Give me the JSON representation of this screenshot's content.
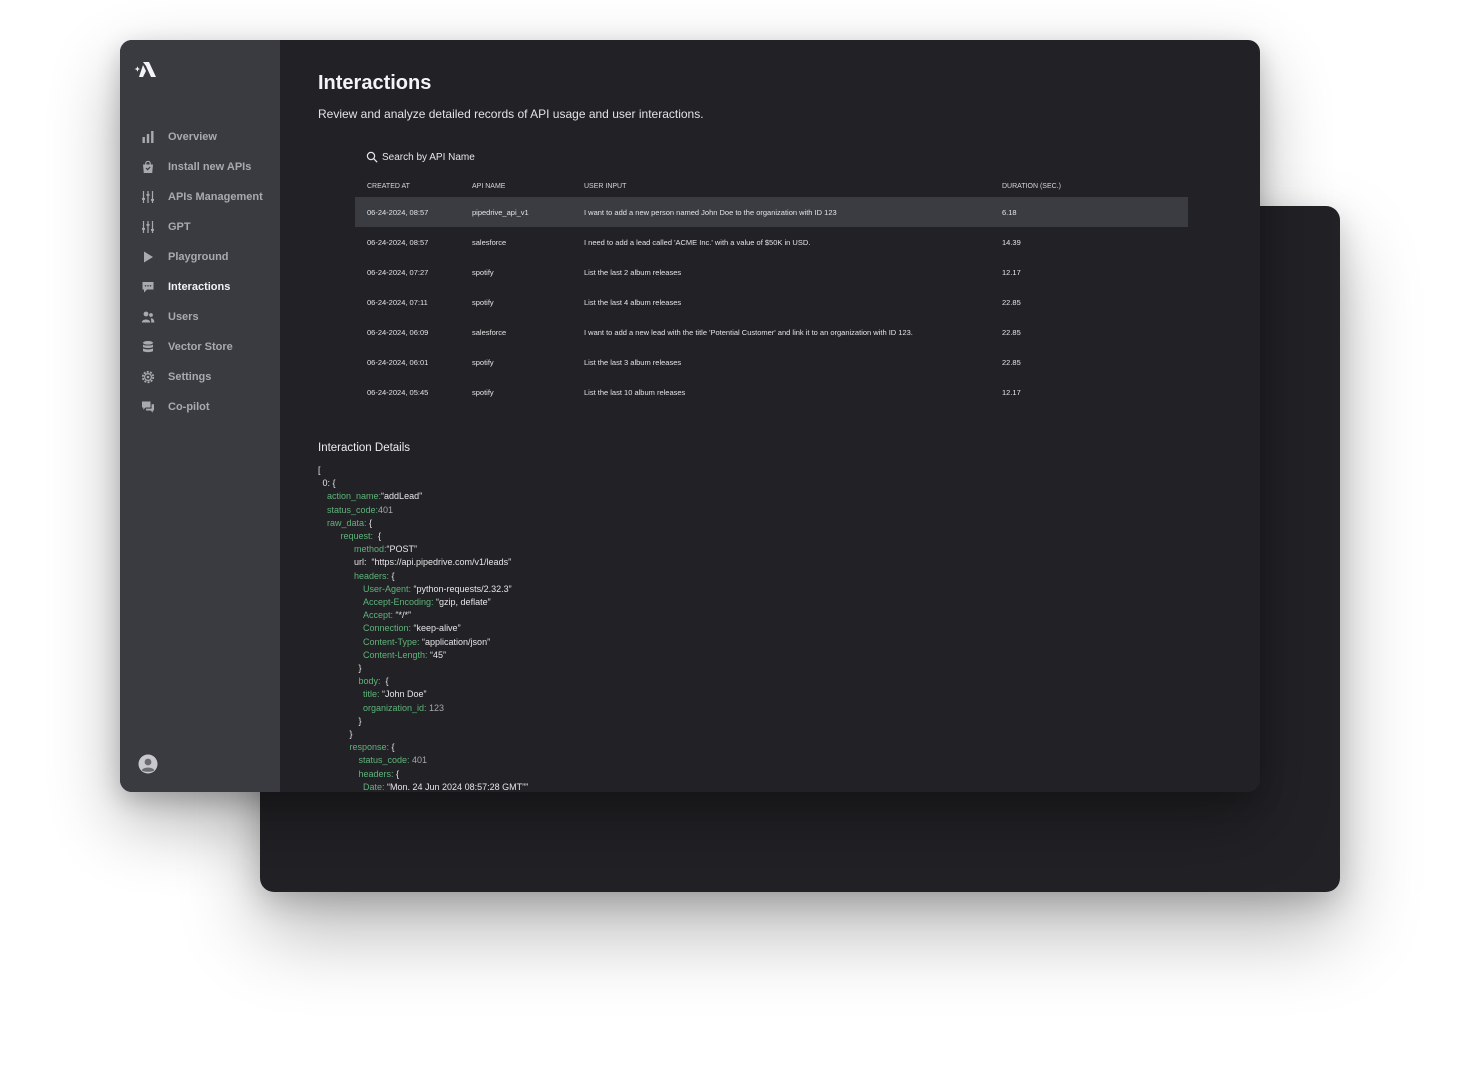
{
  "sidebar": {
    "items": [
      {
        "label": "Overview",
        "icon": "bar-chart-icon"
      },
      {
        "label": "Install new APIs",
        "icon": "shopping-bag-icon"
      },
      {
        "label": "APIs Management",
        "icon": "sliders-icon"
      },
      {
        "label": "GPT",
        "icon": "sliders-icon"
      },
      {
        "label": "Playground",
        "icon": "play-icon"
      },
      {
        "label": "Interactions",
        "icon": "chat-bubble-icon",
        "active": true
      },
      {
        "label": "Users",
        "icon": "users-icon"
      },
      {
        "label": "Vector Store",
        "icon": "database-icon"
      },
      {
        "label": "Settings",
        "icon": "gear-icon"
      },
      {
        "label": "Co-pilot",
        "icon": "chat-bubbles-icon"
      }
    ]
  },
  "page": {
    "title": "Interactions",
    "subtitle": "Review and analyze detailed records of API usage and user interactions."
  },
  "search": {
    "placeholder": "Search by API Name"
  },
  "table": {
    "headers": {
      "created_at": "CREATED AT",
      "api_name": "API NAME",
      "user_input": "USER INPUT",
      "duration": "DURATION (SEC.)"
    },
    "rows": [
      {
        "created_at": "06-24-2024, 08:57",
        "api_name": "pipedrive_api_v1",
        "user_input": "I want to add a new person named John Doe to the organization with ID 123",
        "duration": "6.18",
        "selected": true
      },
      {
        "created_at": "06-24-2024, 08:57",
        "api_name": "salesforce",
        "user_input": "I need to add a lead called 'ACME Inc.' with a value of $50K in USD.",
        "duration": "14.39"
      },
      {
        "created_at": "06-24-2024, 07:27",
        "api_name": "spotify",
        "user_input": "List the last 2 album releases",
        "duration": "12.17"
      },
      {
        "created_at": "06-24-2024, 07:11",
        "api_name": "spotify",
        "user_input": "List the last 4 album releases",
        "duration": "22.85"
      },
      {
        "created_at": "06-24-2024, 06:09",
        "api_name": "salesforce",
        "user_input": "I want to add a new lead with the title 'Potential Customer' and link it to an organization with ID 123.",
        "duration": "22.85"
      },
      {
        "created_at": "06-24-2024, 06:01",
        "api_name": "spotify",
        "user_input": "List the last 3 album releases",
        "duration": "22.85"
      },
      {
        "created_at": "06-24-2024, 05:45",
        "api_name": "spotify",
        "user_input": "List the last 10 album releases",
        "duration": "12.17"
      }
    ]
  },
  "details": {
    "title": "Interaction Details",
    "lines": [
      {
        "indent": 0,
        "text": "["
      },
      {
        "indent": 1,
        "text": "0: {"
      },
      {
        "indent": 2,
        "key": "action_name:",
        "value": "“addLead”"
      },
      {
        "indent": 2,
        "key": "status_code:",
        "value": "401",
        "num": true
      },
      {
        "indent": 2,
        "key": "raw_data:",
        "value": " {"
      },
      {
        "indent": 5,
        "key": "request:",
        "value": "  {"
      },
      {
        "indent": 8,
        "key": "method:",
        "value": "“POST”"
      },
      {
        "indent": 8,
        "text": "url:  “https://api.pipedrive.com/v1/leads”"
      },
      {
        "indent": 8,
        "key": "headers:",
        "value": " {"
      },
      {
        "indent": 10,
        "key": "User-Agent:",
        "value": " “python-requests/2.32.3”"
      },
      {
        "indent": 10,
        "key": "Accept-Encoding:",
        "value": " “gzip, deflate”"
      },
      {
        "indent": 10,
        "key": "Accept:",
        "value": " “*/*”"
      },
      {
        "indent": 10,
        "key": "Connection:",
        "value": " “keep-alive”"
      },
      {
        "indent": 10,
        "key": "Content-Type:",
        "value": " “application/json”"
      },
      {
        "indent": 10,
        "key": "Content-Length:",
        "value": " “45”"
      },
      {
        "indent": 9,
        "text": "}"
      },
      {
        "indent": 9,
        "key": "body:",
        "value": "  {"
      },
      {
        "indent": 10,
        "key": "title:",
        "value": " “John Doe”"
      },
      {
        "indent": 10,
        "key": "organization_id:",
        "value": " 123",
        "num": true
      },
      {
        "indent": 9,
        "text": "}"
      },
      {
        "indent": 7,
        "text": "}"
      },
      {
        "indent": 7,
        "key": "response:",
        "value": " {"
      },
      {
        "indent": 9,
        "key": "status_code:",
        "value": " 401",
        "num": true
      },
      {
        "indent": 9,
        "key": "headers:",
        "value": " {"
      },
      {
        "indent": 10,
        "key": "Date:",
        "value": " “Mon. 24 Jun 2024 08:57:28 GMT””"
      }
    ]
  },
  "colors": {
    "sidebar_bg": "#3a3b40",
    "content_bg": "#222226",
    "selected_row_bg": "#3b3c41",
    "json_key": "#5fb37a"
  }
}
